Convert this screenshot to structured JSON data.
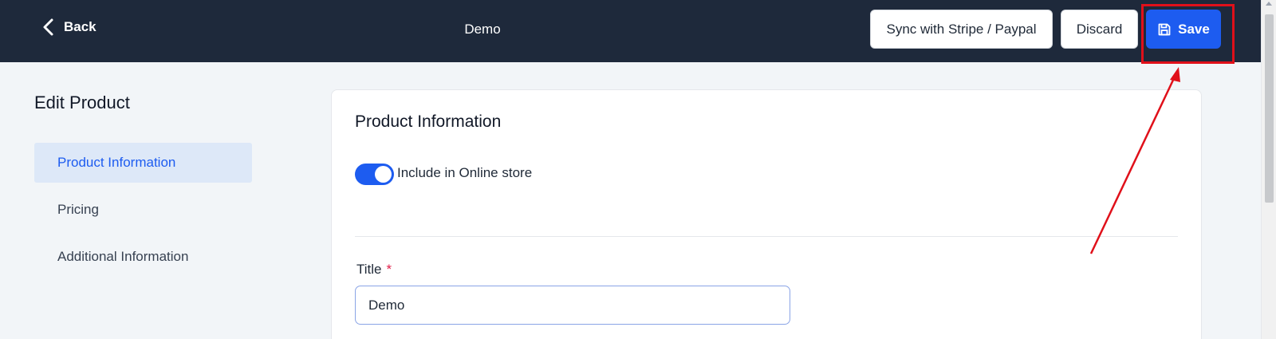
{
  "header": {
    "back_label": "Back",
    "title": "Demo",
    "sync_label": "Sync with Stripe / Paypal",
    "discard_label": "Discard",
    "save_label": "Save"
  },
  "sidebar": {
    "heading": "Edit Product",
    "items": [
      {
        "label": "Product Information",
        "active": true
      },
      {
        "label": "Pricing",
        "active": false
      },
      {
        "label": "Additional Information",
        "active": false
      }
    ]
  },
  "main": {
    "section_title": "Product Information",
    "toggle_label": "Include in Online store",
    "toggle_on": true,
    "title_field_label": "Title",
    "required_marker": "*",
    "title_value": "Demo"
  },
  "colors": {
    "topbar": "#1e293b",
    "accent": "#1d5cf0",
    "annotation": "#e0101a"
  },
  "icons": {
    "back": "chevron-left-icon",
    "save": "floppy-disk-icon"
  }
}
